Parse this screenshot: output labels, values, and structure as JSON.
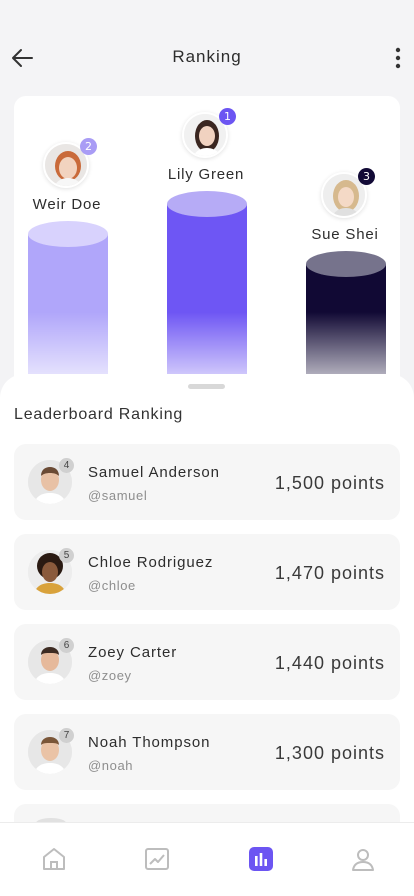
{
  "header": {
    "title": "Ranking",
    "back_icon": "arrow-left-icon",
    "more_icon": "more-vertical-icon"
  },
  "podium": {
    "winners": [
      {
        "rank": "2",
        "name": "Weir Doe",
        "color": "#b1a7fa",
        "badge_color": "#a99cf5"
      },
      {
        "rank": "1",
        "name": "Lily Green",
        "color": "#6c55f2",
        "badge_color": "#6c55f2"
      },
      {
        "rank": "3",
        "name": "Sue Shei",
        "color": "#120a36",
        "badge_color": "#120a36"
      }
    ]
  },
  "leaderboard": {
    "title": "Leaderboard Ranking",
    "rows": [
      {
        "rank": "4",
        "name": "Samuel Anderson",
        "handle": "@samuel",
        "points": "1,500 points"
      },
      {
        "rank": "5",
        "name": "Chloe Rodriguez",
        "handle": "@chloe",
        "points": "1,470 points"
      },
      {
        "rank": "6",
        "name": "Zoey Carter",
        "handle": "@zoey",
        "points": "1,440 points"
      },
      {
        "rank": "7",
        "name": "Noah Thompson",
        "handle": "@noah",
        "points": "1,300 points"
      }
    ]
  },
  "nav": {
    "items": [
      {
        "icon": "home-icon",
        "active": false
      },
      {
        "icon": "chart-line-icon",
        "active": false
      },
      {
        "icon": "bar-chart-icon",
        "active": true
      },
      {
        "icon": "profile-icon",
        "active": false
      }
    ],
    "accent": "#6c55f2"
  }
}
